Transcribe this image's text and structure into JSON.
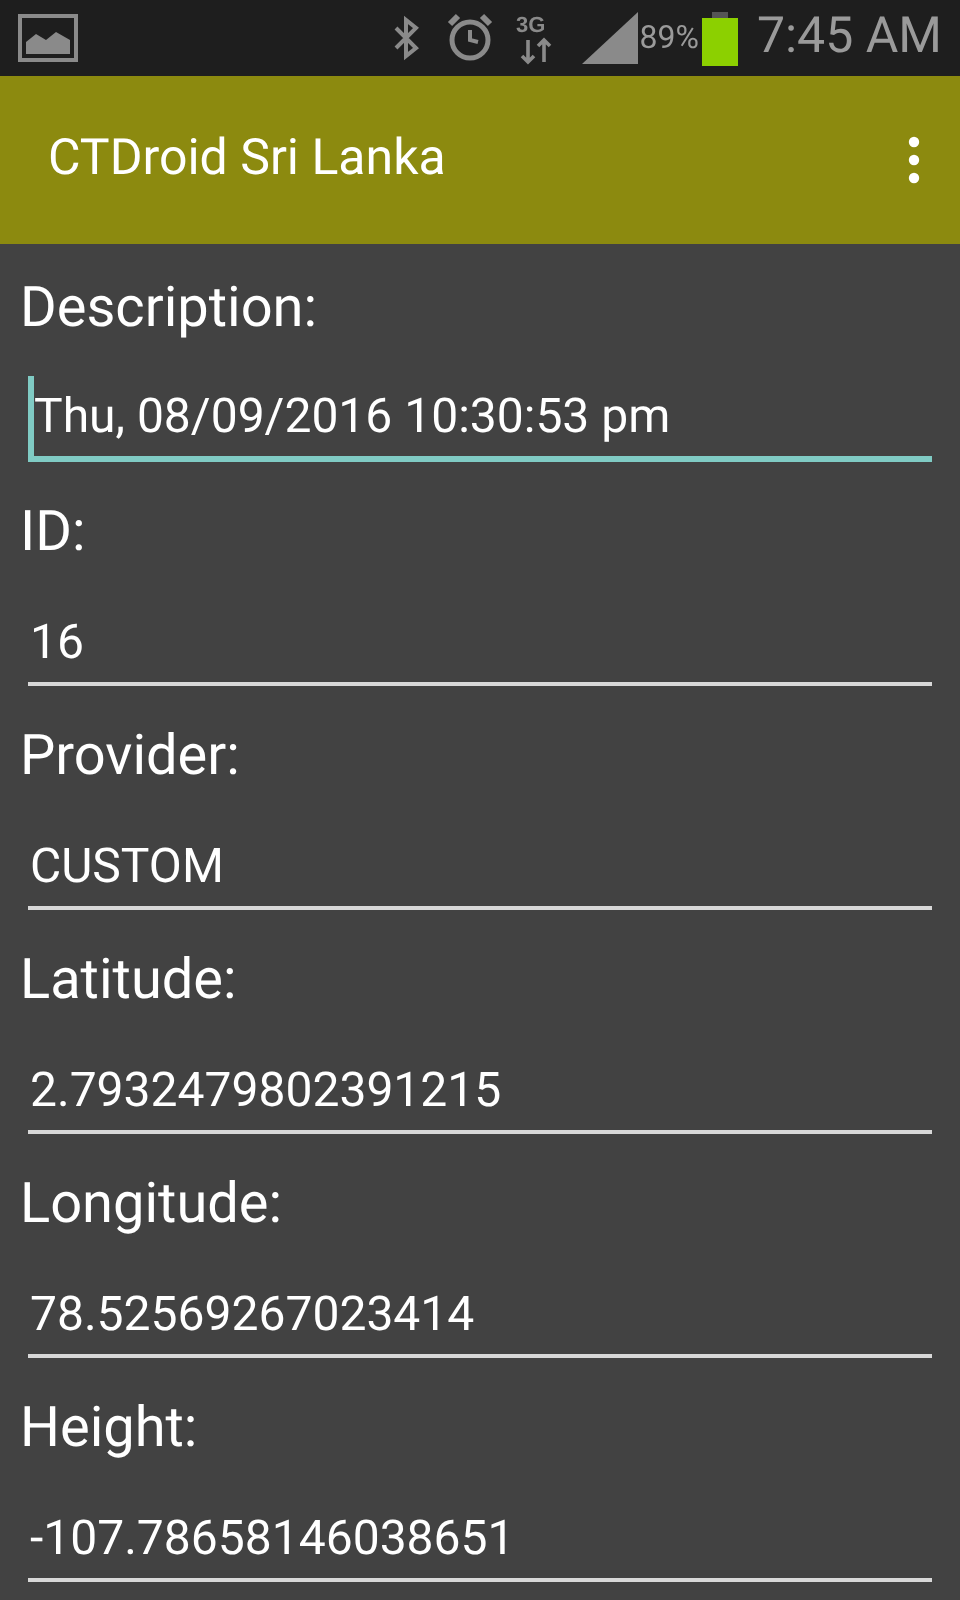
{
  "status_bar": {
    "network": "3G",
    "battery": "89%",
    "time": "7:45 AM"
  },
  "app_bar": {
    "title": "CTDroid Sri Lanka"
  },
  "fields": [
    {
      "label": "Description:",
      "value": "Thu, 08/09/2016 10:30:53 pm",
      "focused": true
    },
    {
      "label": "ID:",
      "value": "16",
      "focused": false
    },
    {
      "label": "Provider:",
      "value": "CUSTOM",
      "focused": false
    },
    {
      "label": "Latitude:",
      "value": "2.7932479802391215",
      "focused": false
    },
    {
      "label": "Longitude:",
      "value": "78.52569267023414",
      "focused": false
    },
    {
      "label": "Height:",
      "value": "-107.78658146038651",
      "focused": false
    }
  ]
}
